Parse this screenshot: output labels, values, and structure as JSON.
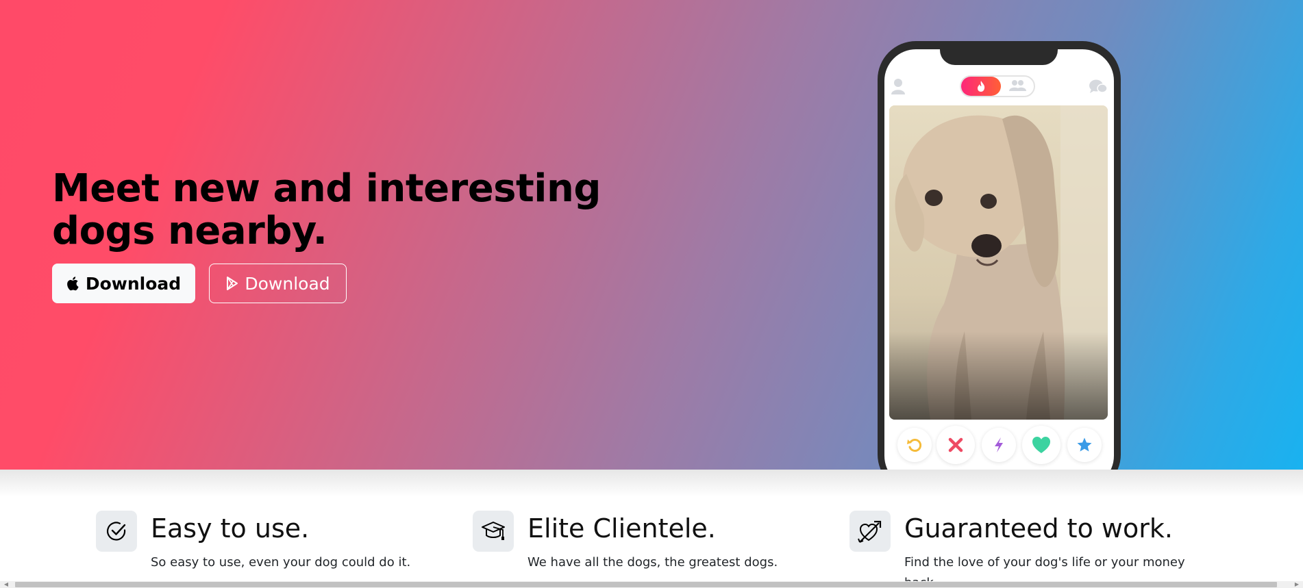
{
  "hero": {
    "title": "Meet new and interesting dogs nearby.",
    "apple_button_label": "Download",
    "play_button_label": "Download"
  },
  "app_preview": {
    "toggle_selected": "fire",
    "actions": [
      "rewind-icon",
      "nope-icon",
      "boost-icon",
      "like-icon",
      "super-like-icon"
    ]
  },
  "features": [
    {
      "icon": "check-circle-icon",
      "title": "Easy to use.",
      "text": "So easy to use, even your dog could do it."
    },
    {
      "icon": "graduation-cap-icon",
      "title": "Elite Clientele.",
      "text": "We have all the dogs, the greatest dogs."
    },
    {
      "icon": "heart-arrow-icon",
      "title": "Guaranteed to work.",
      "text": "Find the love of your dog's life or your money back."
    }
  ],
  "colors": {
    "gradient_start": "#ff4c68",
    "gradient_end": "#19b2f0",
    "like": "#3cd3a0",
    "nope": "#ee4a63",
    "rewind": "#f5bb3a",
    "boost": "#a35bd9",
    "super_like": "#3a9be7"
  }
}
